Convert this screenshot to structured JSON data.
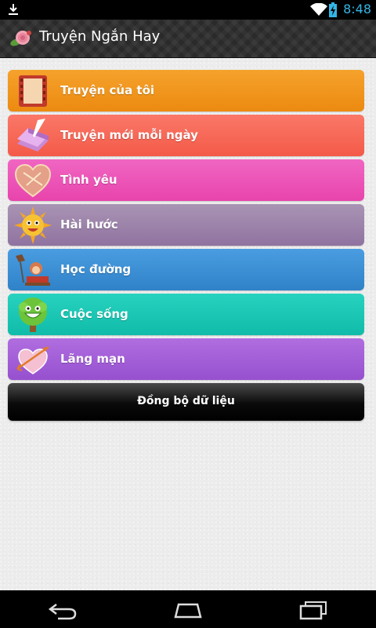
{
  "status_bar": {
    "time": "8:48",
    "icons": [
      "download-icon",
      "wifi-icon",
      "battery-charging-icon"
    ],
    "time_color": "#33b5e5"
  },
  "action_bar": {
    "title": "Truyện Ngắn Hay",
    "logo_icon": "rose-icon"
  },
  "menu": {
    "items": [
      {
        "label": "Truyện của tôi",
        "icon": "film-notebook-icon",
        "color": "#f0931a"
      },
      {
        "label": "Truyện mới mỗi ngày",
        "icon": "book-quill-icon",
        "color": "#f8695a"
      },
      {
        "label": "Tình yêu",
        "icon": "heart-icon",
        "color": "#ee52b6"
      },
      {
        "label": "Hài hước",
        "icon": "smiling-sun-icon",
        "color": "#9d82a8"
      },
      {
        "label": "Học đường",
        "icon": "student-desk-icon",
        "color": "#3d8fd4"
      },
      {
        "label": "Cuộc sống",
        "icon": "smiling-tree-icon",
        "color": "#19c8b6"
      },
      {
        "label": "Lãng mạn",
        "icon": "heart-arrow-icon",
        "color": "#a35ed8"
      }
    ],
    "sync_label": "Đồng bộ dữ liệu"
  },
  "nav_bar": {
    "buttons": [
      "back-icon",
      "home-icon",
      "recent-apps-icon"
    ]
  }
}
